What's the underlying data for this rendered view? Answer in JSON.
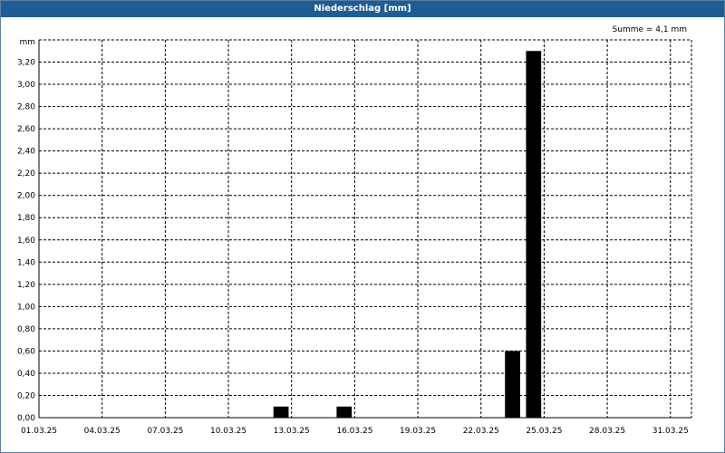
{
  "window": {
    "title": "Niederschlag [mm]"
  },
  "summary": "Summe = 4,1 mm",
  "colors": {
    "titlebar": "#1f5c94",
    "bar": "#000000",
    "grid": "#000000"
  },
  "chart_data": {
    "type": "bar",
    "title": "Niederschlag [mm]",
    "ylabel": "mm",
    "xlabel": "",
    "ylim": [
      0,
      3.4
    ],
    "xlim": [
      "01.03.25",
      "01.04.25"
    ],
    "grid": true,
    "y_ticks": [
      "0,00",
      "0,20",
      "0,40",
      "0,60",
      "0,80",
      "1,00",
      "1,20",
      "1,40",
      "1,60",
      "1,80",
      "2,00",
      "2,20",
      "2,40",
      "2,60",
      "2,80",
      "3,00",
      "3,20"
    ],
    "x_ticks": [
      "01.03.25",
      "04.03.25",
      "07.03.25",
      "10.03.25",
      "13.03.25",
      "16.03.25",
      "19.03.25",
      "22.03.25",
      "25.03.25",
      "28.03.25",
      "31.03.25"
    ],
    "categories": [
      "01.03.25",
      "02.03.25",
      "03.03.25",
      "04.03.25",
      "05.03.25",
      "06.03.25",
      "07.03.25",
      "08.03.25",
      "09.03.25",
      "10.03.25",
      "11.03.25",
      "12.03.25",
      "13.03.25",
      "14.03.25",
      "15.03.25",
      "16.03.25",
      "17.03.25",
      "18.03.25",
      "19.03.25",
      "20.03.25",
      "21.03.25",
      "22.03.25",
      "23.03.25",
      "24.03.25",
      "25.03.25",
      "26.03.25",
      "27.03.25",
      "28.03.25",
      "29.03.25",
      "30.03.25",
      "31.03.25"
    ],
    "values": [
      0,
      0,
      0,
      0,
      0,
      0,
      0,
      0,
      0,
      0,
      0,
      0.1,
      0,
      0,
      0.1,
      0,
      0,
      0,
      0,
      0,
      0,
      0,
      0.6,
      3.3,
      0,
      0,
      0,
      0,
      0,
      0,
      0
    ]
  }
}
